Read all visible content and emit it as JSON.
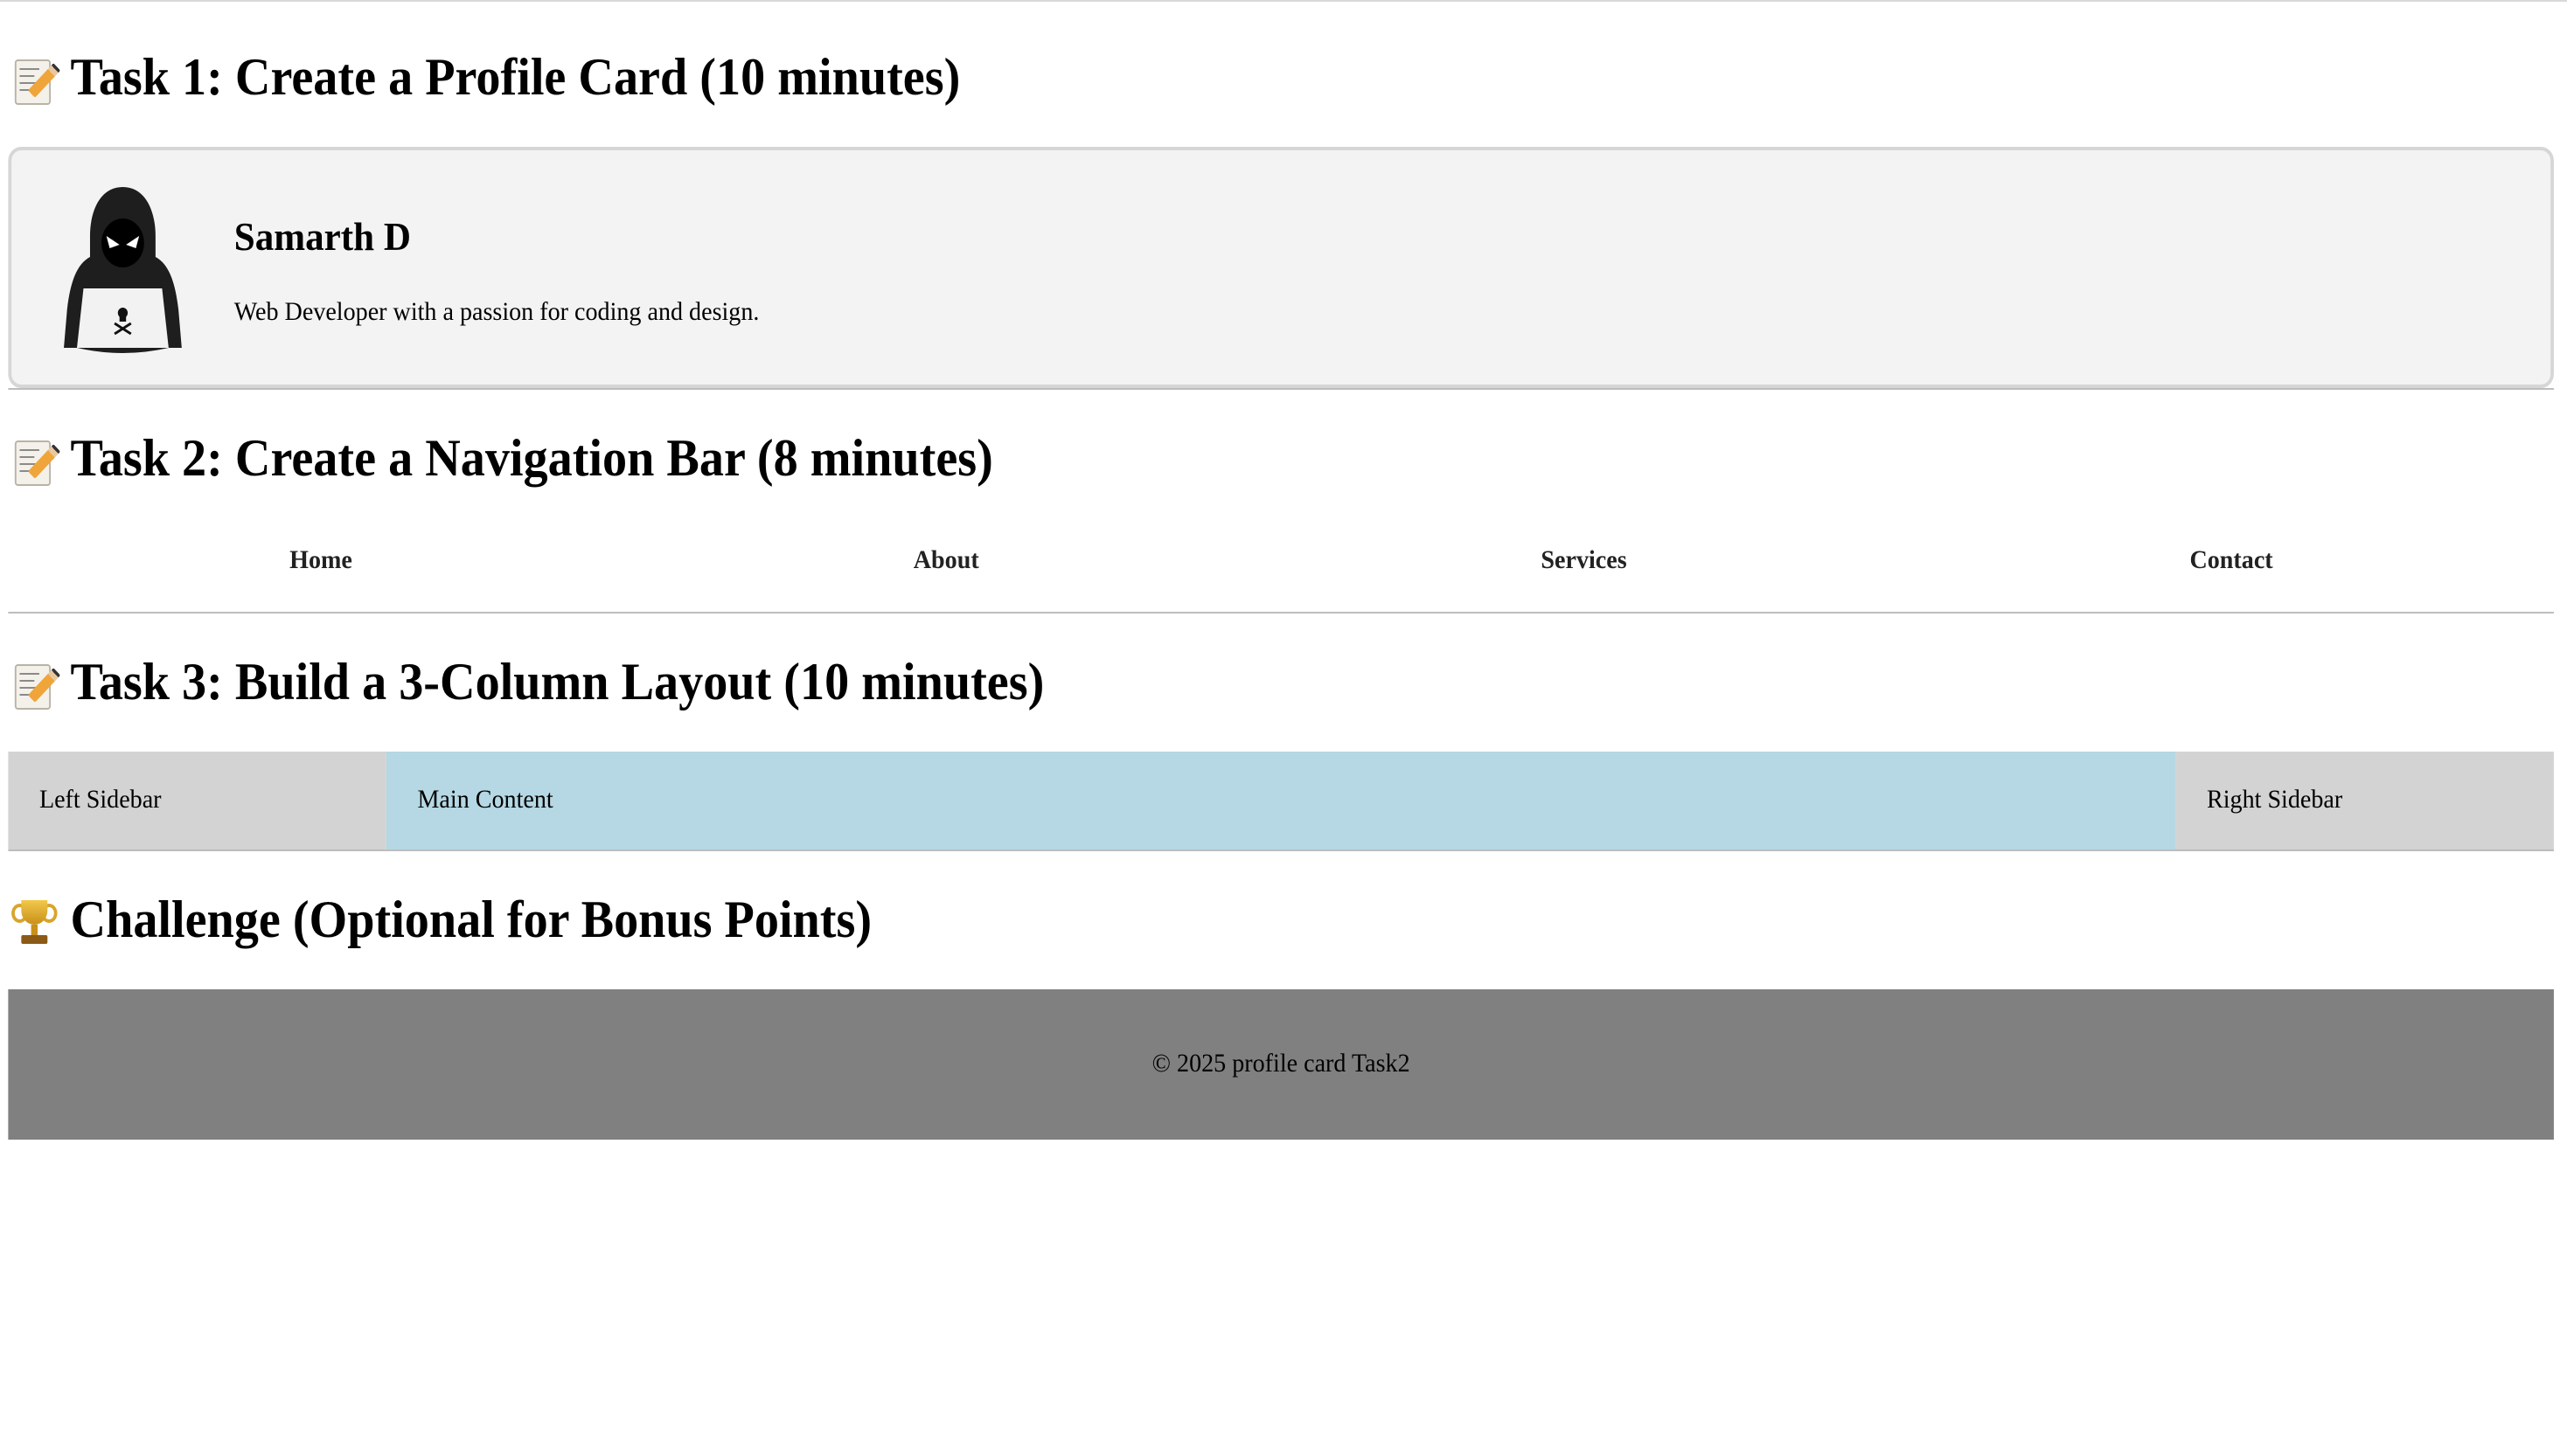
{
  "task1": {
    "heading": "Task 1: Create a Profile Card (10 minutes)",
    "icon": "memo-icon",
    "profile": {
      "name": "Samarth D",
      "bio": "Web Developer with a passion for coding and design.",
      "avatar_icon": "hacker-avatar-icon"
    }
  },
  "task2": {
    "heading": "Task 2: Create a Navigation Bar (8 minutes)",
    "icon": "memo-icon",
    "nav": [
      "Home",
      "About",
      "Services",
      "Contact"
    ]
  },
  "task3": {
    "heading": "Task 3: Build a 3-Column Layout (10 minutes)",
    "icon": "memo-icon",
    "columns": {
      "left": "Left Sidebar",
      "main": "Main Content",
      "right": "Right Sidebar"
    },
    "colors": {
      "sidebar": "#d3d3d3",
      "main": "#b5d8e4"
    }
  },
  "challenge": {
    "heading": "Challenge (Optional for Bonus Points)",
    "icon": "trophy-icon"
  },
  "footer": {
    "text": "© 2025 profile card Task2",
    "background": "#808080"
  }
}
